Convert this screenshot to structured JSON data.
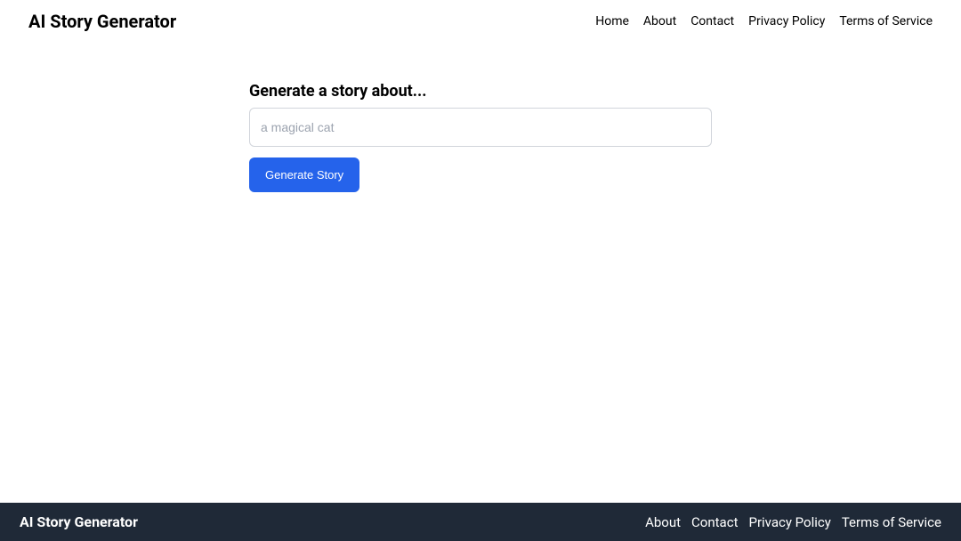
{
  "header": {
    "title": "AI Story Generator",
    "nav": {
      "home": "Home",
      "about": "About",
      "contact": "Contact",
      "privacy": "Privacy Policy",
      "terms": "Terms of Service"
    }
  },
  "form": {
    "label": "Generate a story about...",
    "placeholder": "a magical cat",
    "button": "Generate Story"
  },
  "footer": {
    "title": "AI Story Generator",
    "nav": {
      "about": "About",
      "contact": "Contact",
      "privacy": "Privacy Policy",
      "terms": "Terms of Service"
    }
  }
}
